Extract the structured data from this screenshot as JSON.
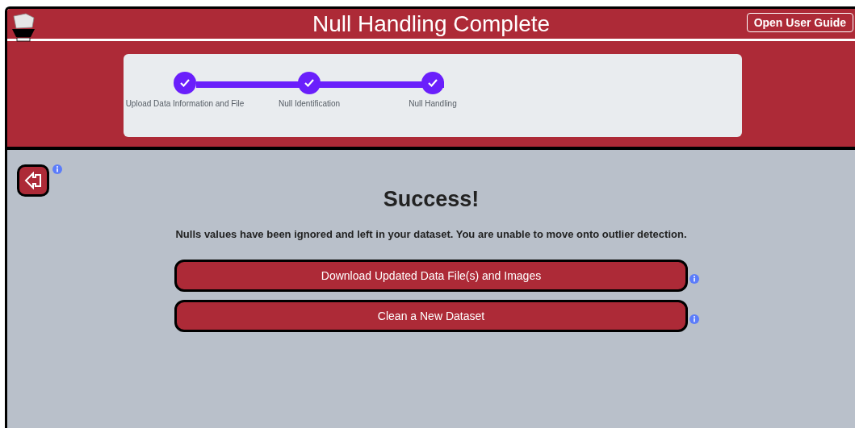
{
  "header": {
    "title": "Null Handling Complete",
    "guide_button": "Open User Guide"
  },
  "steps": [
    {
      "label": "Upload Data Information and File",
      "completed": true
    },
    {
      "label": "Null Identification",
      "completed": true
    },
    {
      "label": "Null Handling",
      "completed": true
    }
  ],
  "content": {
    "heading": "Success!",
    "message": "Nulls values have been ignored and left in your dataset. You are unable to move onto outlier detection.",
    "actions": [
      "Download Updated Data File(s) and Images",
      "Clean a New Dataset"
    ]
  }
}
